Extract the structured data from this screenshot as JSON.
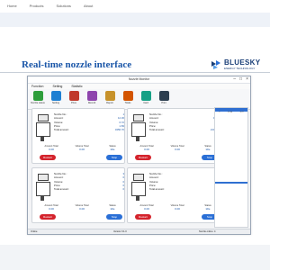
{
  "top_nav": [
    "Home",
    "Products",
    "Solutions",
    "About"
  ],
  "headline": "Real-time nozzle interface",
  "brand": {
    "name": "BLUESKY",
    "tagline": "ENERGY TECHNOLOGY",
    "color": "#1a3f78"
  },
  "window": {
    "title": "Nozzle Monitor",
    "menu": [
      "Function",
      "Setting",
      "Statistic"
    ],
    "toolbar": [
      {
        "label": "Nozzle status",
        "icon": "nozzle-icon",
        "color": "#2e9e3c"
      },
      {
        "label": "Setting",
        "icon": "settings-icon",
        "color": "#1e7fd2"
      },
      {
        "label": "Price",
        "icon": "price-icon",
        "color": "#c0392b"
      },
      {
        "label": "Record",
        "icon": "record-icon",
        "color": "#8e44ad"
      },
      {
        "label": "Report",
        "icon": "report-icon",
        "color": "#c7922b"
      },
      {
        "label": "Totals",
        "icon": "totals-icon",
        "color": "#d35400"
      },
      {
        "label": "Card",
        "icon": "card-icon",
        "color": "#16a085"
      },
      {
        "label": "Print",
        "icon": "print-icon",
        "color": "#2c3e50"
      }
    ],
    "nozzle_panels": [
      {
        "params": [
          {
            "k": "Nozzle No.:",
            "v": "1"
          },
          {
            "k": "Amount:",
            "v": "12.30"
          },
          {
            "k": "Volume:",
            "v": "6.72"
          },
          {
            "k": "Price:",
            "v": "1.83"
          },
          {
            "k": "Total amount:",
            "v": "3456.70"
          }
        ],
        "stats": [
          {
            "k": "Amount Total",
            "v": "0.00"
          },
          {
            "k": "Volume Total",
            "v": "0.00"
          },
          {
            "k": "Status",
            "v": "Idle"
          }
        ],
        "buttons": {
          "restart": "Restart",
          "stop": "Stop"
        }
      },
      {
        "params": [
          {
            "k": "Nozzle No.:",
            "v": "2"
          },
          {
            "k": "Amount:",
            "v": "18.20"
          },
          {
            "k": "Volume:",
            "v": "9.94"
          },
          {
            "k": "Price:",
            "v": "1.83"
          },
          {
            "k": "Total amount:",
            "v": "2104.10"
          }
        ],
        "stats": [
          {
            "k": "Amount Total",
            "v": "0.00"
          },
          {
            "k": "Volume Total",
            "v": "0.00"
          },
          {
            "k": "Status",
            "v": "Idle"
          }
        ],
        "buttons": {
          "restart": "Restart",
          "stop": "Stop"
        }
      },
      {
        "params": [
          {
            "k": "Nozzle No.:",
            "v": "3"
          },
          {
            "k": "Amount:",
            "v": "0"
          },
          {
            "k": "Volume:",
            "v": "0"
          },
          {
            "k": "Price:",
            "v": "0"
          },
          {
            "k": "Total amount:",
            "v": "0"
          }
        ],
        "stats": [
          {
            "k": "Amount Total",
            "v": "0.00"
          },
          {
            "k": "Volume Total",
            "v": "0.00"
          },
          {
            "k": "Status",
            "v": "Idle"
          }
        ],
        "buttons": {
          "restart": "Restart",
          "stop": "Stop"
        }
      },
      {
        "params": [
          {
            "k": "Nozzle No.:",
            "v": "4"
          },
          {
            "k": "Amount:",
            "v": "0"
          },
          {
            "k": "Volume:",
            "v": "0"
          },
          {
            "k": "Price:",
            "v": "0"
          },
          {
            "k": "Total amount:",
            "v": "0"
          }
        ],
        "stats": [
          {
            "k": "Amount Total",
            "v": "0.00"
          },
          {
            "k": "Volume Total",
            "v": "0.00"
          },
          {
            "k": "Status",
            "v": "Idle"
          }
        ],
        "buttons": {
          "restart": "Restart",
          "stop": "Stop"
        }
      }
    ],
    "right_rows": [
      [
        "1",
        "12.30",
        "6.72"
      ]
    ],
    "status_bar": {
      "left": "Online",
      "center": "Version V1.0",
      "right": "Nozzle online: 4"
    },
    "colors": {
      "restart": "#d4232c",
      "stop": "#2a6fd6",
      "accent": "#1a56a8"
    }
  }
}
